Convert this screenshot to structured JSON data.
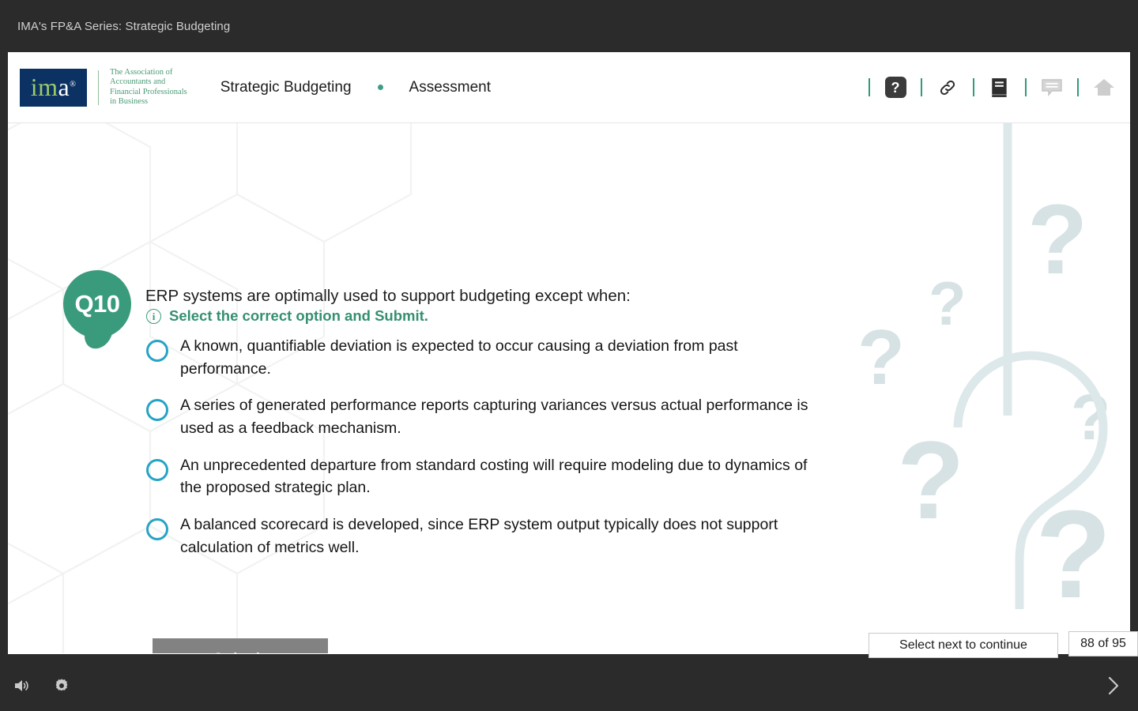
{
  "player": {
    "course_title": "IMA's FP&A Series: Strategic Budgeting",
    "chrome_color": "#2b2b2b"
  },
  "header": {
    "logo": {
      "mark_i": "i",
      "mark_m": "m",
      "mark_a": "a",
      "mark_registered": "®",
      "tagline_line1": "The Association of",
      "tagline_line2": "Accountants and",
      "tagline_line3": "Financial Professionals",
      "tagline_line4": "in Business",
      "mark_bg": "#0b3263",
      "tagline_color": "#4a9a76"
    },
    "breadcrumb": {
      "section": "Strategic Budgeting",
      "page": "Assessment",
      "separator_color": "#3e9e83"
    },
    "tools": [
      {
        "name": "help-icon",
        "label": "?"
      },
      {
        "name": "resources-link-icon",
        "label": ""
      },
      {
        "name": "glossary-book-icon",
        "label": ""
      },
      {
        "name": "notes-icon",
        "label": ""
      },
      {
        "name": "home-icon",
        "label": ""
      }
    ]
  },
  "question": {
    "badge_label": "Q10",
    "badge_color": "#3a9b7c",
    "stem": "ERP systems are optimally used to support budgeting except when:",
    "instruction": "Select the correct option and Submit.",
    "instruction_color": "#349070",
    "radio_color": "#27a3c6",
    "options": [
      {
        "text": "A known, quantifiable deviation is expected to occur causing a deviation from past performance.",
        "selected": false
      },
      {
        "text": "A series of generated performance reports capturing variances versus actual performance is used as a feedback mechanism.",
        "selected": false
      },
      {
        "text": "An unprecedented departure from standard costing will require modeling due to dynamics of the proposed strategic plan.",
        "selected": false
      },
      {
        "text": "A balanced scorecard is developed, since ERP system output typically does not support calculation of metrics well.",
        "selected": false
      }
    ],
    "submit_label": "Submit",
    "submit_color": "#828282"
  },
  "footer": {
    "tooltip": "Select next to continue",
    "page_counter": "88 of 95",
    "controls": [
      {
        "name": "volume-icon"
      },
      {
        "name": "settings-gear-icon"
      },
      {
        "name": "next-chevron-icon"
      }
    ]
  }
}
